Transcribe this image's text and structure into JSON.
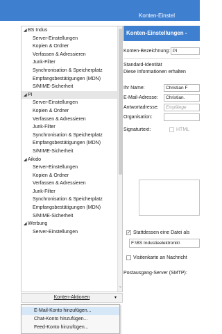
{
  "window": {
    "title": "Konten-Einstel",
    "faint_text": ""
  },
  "sidebar": {
    "accounts": [
      {
        "name": "BS Indus",
        "expanded": true,
        "selected": false,
        "items": [
          "Server-Einstellungen",
          "Kopien & Ordner",
          "Verfassen & Adressieren",
          "Junk-Filter",
          "Synchronisation & Speicherplatz",
          "Empfangsbestätigungen (MDN)",
          "S/MIME-Sicherheit"
        ]
      },
      {
        "name": "PI",
        "expanded": true,
        "selected": true,
        "items": [
          "Server-Einstellungen",
          "Kopien & Ordner",
          "Verfassen & Adressieren",
          "Junk-Filter",
          "Synchronisation & Speicherplatz",
          "Empfangsbestätigungen (MDN)",
          "S/MIME-Sicherheit"
        ]
      },
      {
        "name": "Aikido",
        "expanded": true,
        "selected": false,
        "items": [
          "Server-Einstellungen",
          "Kopien & Ordner",
          "Verfassen & Adressieren",
          "Junk-Filter",
          "Synchronisation & Speicherplatz",
          "Empfangsbestätigungen (MDN)",
          "S/MIME-Sicherheit"
        ]
      },
      {
        "name": "Werbung",
        "expanded": true,
        "selected": false,
        "items": [
          "Server-Einstellungen"
        ]
      }
    ]
  },
  "actions": {
    "label": "Konten-Aktionen"
  },
  "menu": {
    "items": [
      "E-Mail-Konto hinzufügen...",
      "Chat-Konto hinzufügen...",
      "Feed-Konto hinzufügen..."
    ],
    "hover_index": 0
  },
  "main": {
    "header": "Konten-Einstellungen -",
    "account_name_label": "Konten-Bezeichnung:",
    "account_name_value": "PI",
    "identity_section": "Standard-Identität",
    "identity_desc": "Diese Informationen erhalten",
    "name_label": "Ihr Name:",
    "name_value": "Christian F",
    "email_label": "E-Mail-Adresse:",
    "email_value": "Christian.",
    "reply_label": "Antwortadresse:",
    "reply_placeholder": "Empfänge",
    "org_label": "Organisation:",
    "org_value": "",
    "signature_label": "Signaturtext:",
    "html_label": "HTML",
    "file_checkbox_label": "Stattdessen eine Datei als",
    "file_path": "F:\\BS Industieelektronik\\",
    "vcard_label": "Visitenkarte an Nachricht",
    "smtp_label": "Postausgang-Server (SMTP):"
  },
  "colors": {
    "accent": "#3f7fd0",
    "hover": "#d6e7f8",
    "selected": "#e6e6e6"
  }
}
